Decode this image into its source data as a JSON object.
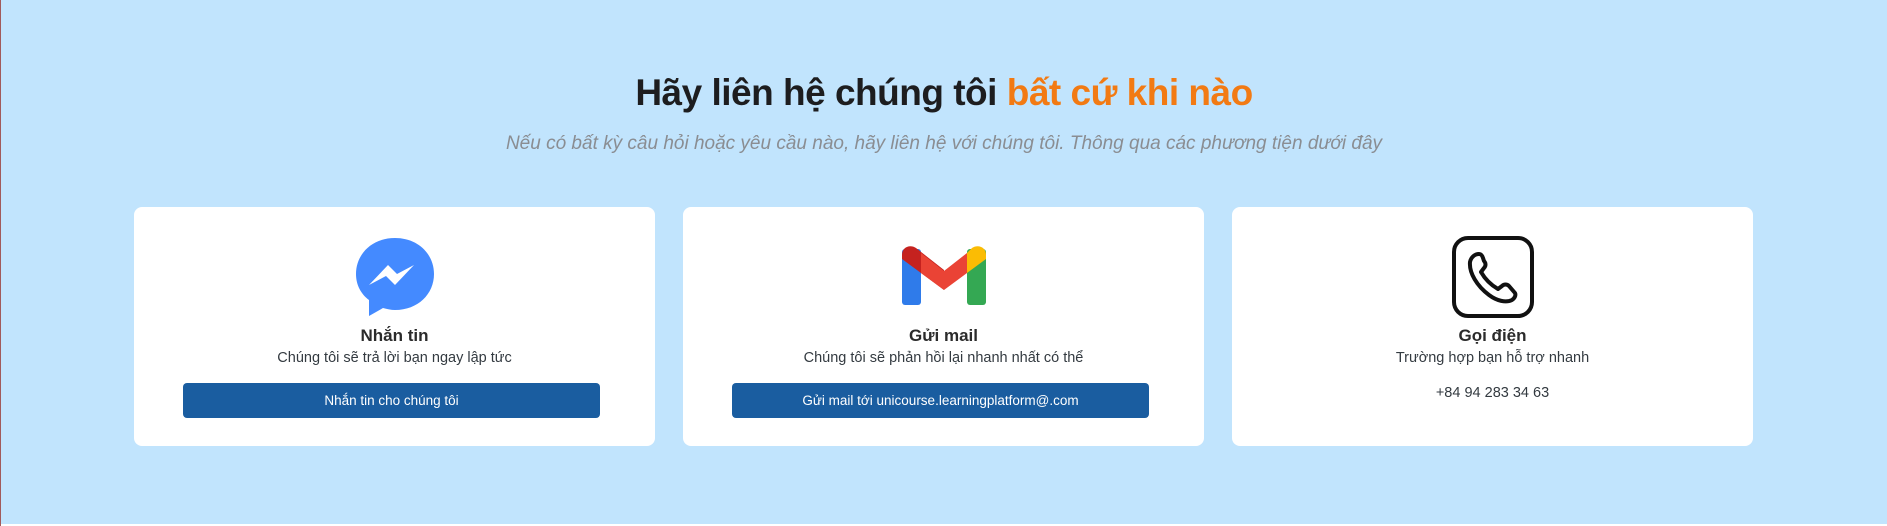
{
  "header": {
    "title_main": "Hãy liên hệ chúng tôi ",
    "title_accent": "bất cứ khi nào",
    "subtitle": "Nếu có bất kỳ câu hỏi hoặc yêu cầu nào, hãy liên hệ với chúng tôi. Thông qua các phương tiện dưới đây"
  },
  "colors": {
    "background": "#c1e4fd",
    "accent": "#f27a13",
    "button": "#1a5da0",
    "messenger": "#448aff"
  },
  "cards": [
    {
      "icon": "messenger-icon",
      "title": "Nhắn tin",
      "description": "Chúng tôi sẽ trả lời bạn ngay lập tức",
      "button_label": "Nhắn tin cho chúng tôi"
    },
    {
      "icon": "gmail-icon",
      "title": "Gửi mail",
      "description": "Chúng tôi sẽ phản hồi lại nhanh nhất có thể",
      "button_label": "Gửi mail tới unicourse.learningplatform@.com"
    },
    {
      "icon": "phone-icon",
      "title": "Gọi điện",
      "description": "Trường hợp bạn hỗ trợ nhanh",
      "phone": "+84 94 283 34 63"
    }
  ]
}
